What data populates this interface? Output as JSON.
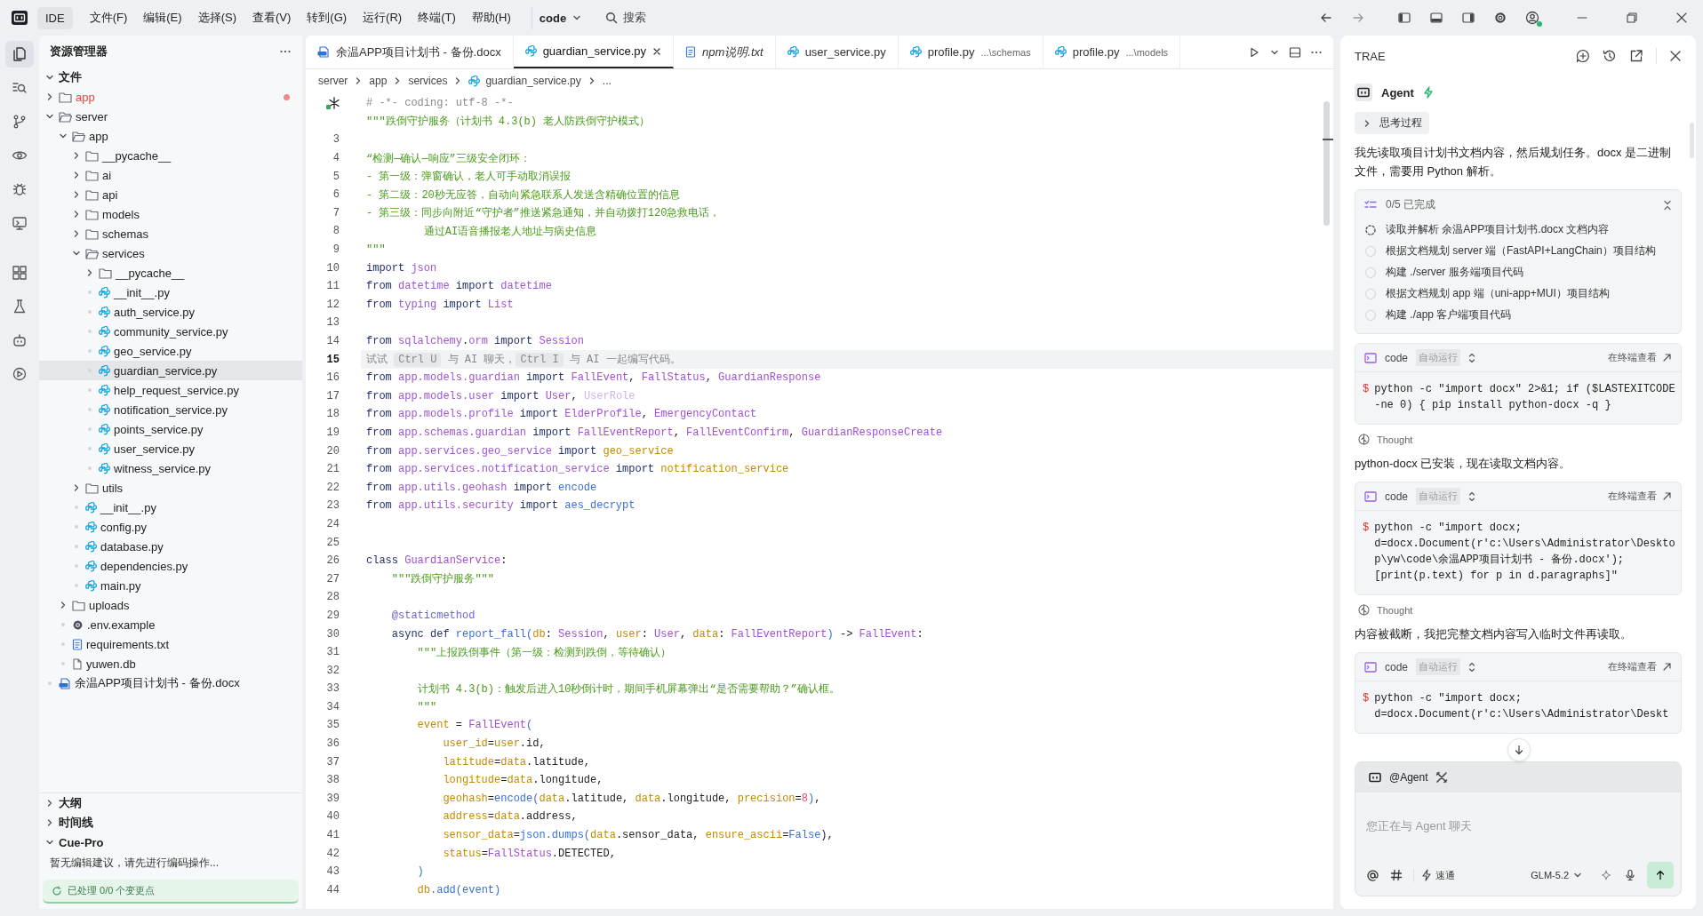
{
  "title_bar": {
    "app_label": "IDE",
    "menus": [
      "文件(F)",
      "编辑(E)",
      "选择(S)",
      "查看(V)",
      "转到(G)",
      "运行(R)",
      "终端(T)",
      "帮助(H)"
    ],
    "workspace": "code",
    "search": {
      "placeholder": "搜索"
    }
  },
  "activity_bar": [
    {
      "selected": true
    },
    {
      "selected": false
    },
    {
      "selected": false
    },
    {
      "selected": false
    },
    {
      "selected": false
    },
    {
      "selected": false
    },
    {
      "selected": false
    },
    {
      "selected": false
    },
    {
      "selected": false
    },
    {
      "selected": false
    }
  ],
  "explorer": {
    "title": "资源管理器",
    "section": {
      "label": "文件",
      "expanded": true
    },
    "tree": [
      {
        "name": "app",
        "kind": "folder",
        "expanded": false,
        "modified": true,
        "selected": false
      },
      {
        "name": "server",
        "kind": "folder",
        "expanded": true,
        "modified": false,
        "selected": false,
        "children": [
          {
            "name": "app",
            "kind": "folder",
            "expanded": true,
            "modified": false,
            "selected": false,
            "children": [
              {
                "name": "__pycache__",
                "kind": "folder",
                "expanded": false,
                "modified": false,
                "selected": false
              },
              {
                "name": "ai",
                "kind": "folder",
                "expanded": false,
                "modified": false,
                "selected": false
              },
              {
                "name": "api",
                "kind": "folder",
                "expanded": false,
                "modified": false,
                "selected": false
              },
              {
                "name": "models",
                "kind": "folder",
                "expanded": false,
                "modified": false,
                "selected": false
              },
              {
                "name": "schemas",
                "kind": "folder",
                "expanded": false,
                "modified": false,
                "selected": false
              },
              {
                "name": "services",
                "kind": "folder",
                "expanded": true,
                "modified": false,
                "selected": false,
                "children": [
                  {
                    "name": "__pycache__",
                    "kind": "folder",
                    "expanded": false,
                    "modified": false,
                    "selected": false
                  },
                  {
                    "name": "__init__.py",
                    "kind": "python",
                    "modified": false,
                    "selected": false
                  },
                  {
                    "name": "auth_service.py",
                    "kind": "python",
                    "modified": false,
                    "selected": false
                  },
                  {
                    "name": "community_service.py",
                    "kind": "python",
                    "modified": false,
                    "selected": false
                  },
                  {
                    "name": "geo_service.py",
                    "kind": "python",
                    "modified": false,
                    "selected": false
                  },
                  {
                    "name": "guardian_service.py",
                    "kind": "python",
                    "modified": false,
                    "selected": true
                  },
                  {
                    "name": "help_request_service.py",
                    "kind": "python",
                    "modified": false,
                    "selected": false
                  },
                  {
                    "name": "notification_service.py",
                    "kind": "python",
                    "modified": false,
                    "selected": false
                  },
                  {
                    "name": "points_service.py",
                    "kind": "python",
                    "modified": false,
                    "selected": false
                  },
                  {
                    "name": "user_service.py",
                    "kind": "python",
                    "modified": false,
                    "selected": false
                  },
                  {
                    "name": "witness_service.py",
                    "kind": "python",
                    "modified": false,
                    "selected": false
                  }
                ]
              },
              {
                "name": "utils",
                "kind": "folder",
                "expanded": false,
                "modified": false,
                "selected": false
              },
              {
                "name": "__init__.py",
                "kind": "python",
                "modified": false,
                "selected": false
              },
              {
                "name": "config.py",
                "kind": "python",
                "modified": false,
                "selected": false
              },
              {
                "name": "database.py",
                "kind": "python",
                "modified": false,
                "selected": false
              },
              {
                "name": "dependencies.py",
                "kind": "python",
                "modified": false,
                "selected": false
              },
              {
                "name": "main.py",
                "kind": "python",
                "modified": false,
                "selected": false
              }
            ]
          },
          {
            "name": "uploads",
            "kind": "folder",
            "expanded": false,
            "modified": false,
            "selected": false
          },
          {
            "name": ".env.example",
            "kind": "config",
            "modified": false,
            "selected": false
          },
          {
            "name": "requirements.txt",
            "kind": "text",
            "modified": false,
            "selected": false
          },
          {
            "name": "yuwen.db",
            "kind": "file",
            "modified": false,
            "selected": false
          }
        ]
      },
      {
        "name": "余温APP项目计划书 - 备份.docx",
        "kind": "document",
        "modified": false,
        "selected": false
      }
    ],
    "panels": [
      {
        "label": "大纲",
        "expanded": false
      },
      {
        "label": "时间线",
        "expanded": false
      },
      {
        "label": "Cue-Pro",
        "expanded": true,
        "message": "暂无编辑建议，请先进行编码操作...",
        "status": "已处理 0/0 个变更点"
      }
    ]
  },
  "editor": {
    "tabs": [
      {
        "label": "余温APP项目计划书 - 备份.docx",
        "kind": "document",
        "selected": false,
        "preview": false
      },
      {
        "label": "guardian_service.py",
        "kind": "python",
        "selected": true,
        "preview": false
      },
      {
        "label": "npm说明.txt",
        "kind": "text",
        "selected": false,
        "preview": true
      },
      {
        "label": "user_service.py",
        "kind": "python",
        "selected": false,
        "preview": false
      },
      {
        "label": "profile.py",
        "kind": "python",
        "selected": false,
        "preview": false,
        "path": "...\\schemas"
      },
      {
        "label": "profile.py",
        "kind": "python",
        "selected": false,
        "preview": false,
        "path": "...\\models"
      }
    ],
    "breadcrumb": [
      "server",
      "app",
      "services",
      "guardian_service.py",
      "..."
    ],
    "lines": [
      {
        "marker": true,
        "current": false,
        "tokens": [
          {
            "text": "# -*- coding: utf-8 -*-",
            "kind": "comment"
          }
        ]
      },
      {
        "current": false,
        "tokens": [
          {
            "text": "\"\"\"跌倒守护服务（计划书 4.3(b) 老人防跌倒守护模式）",
            "kind": "string"
          }
        ]
      },
      {
        "number": "3",
        "current": false
      },
      {
        "number": "4",
        "current": false,
        "tokens": [
          {
            "text": "“检测—确认—响应”三级安全闭环：",
            "kind": "string"
          }
        ]
      },
      {
        "number": "5",
        "current": false,
        "tokens": [
          {
            "text": "- 第一级：弹窗确认，老人可手动取消误报",
            "kind": "string"
          }
        ]
      },
      {
        "number": "6",
        "current": false,
        "tokens": [
          {
            "text": "- 第二级：20秒无应答，自动向紧急联系人发送含精确位置的信息",
            "kind": "string"
          }
        ]
      },
      {
        "number": "7",
        "current": false,
        "tokens": [
          {
            "text": "- 第三级：同步向附近“守护者”推送紧急通知，并自动拨打120急救电话，",
            "kind": "string"
          }
        ]
      },
      {
        "number": "8",
        "current": false,
        "tokens": [
          {
            "text": "         通过AI语音播报老人地址与病史信息",
            "kind": "string"
          }
        ]
      },
      {
        "number": "9",
        "current": false,
        "tokens": [
          {
            "text": "\"\"\"",
            "kind": "string"
          }
        ]
      },
      {
        "number": "10",
        "current": false,
        "tokens": [
          {
            "text": "import",
            "kind": "keyword"
          },
          {
            "text": " json",
            "kind": "module"
          }
        ]
      },
      {
        "number": "11",
        "current": false,
        "tokens": [
          {
            "text": "from",
            "kind": "keyword"
          },
          {
            "text": " datetime ",
            "kind": "module"
          },
          {
            "text": "import",
            "kind": "keyword"
          },
          {
            "text": " datetime",
            "kind": "module"
          }
        ]
      },
      {
        "number": "12",
        "current": false,
        "tokens": [
          {
            "text": "from",
            "kind": "keyword"
          },
          {
            "text": " typing ",
            "kind": "module"
          },
          {
            "text": "import",
            "kind": "keyword"
          },
          {
            "text": " List",
            "kind": "class"
          }
        ]
      },
      {
        "number": "13",
        "current": false
      },
      {
        "number": "14",
        "current": false,
        "tokens": [
          {
            "text": "from",
            "kind": "keyword"
          },
          {
            "text": " sqlalchemy",
            "kind": "module"
          },
          {
            "text": ".",
            "kind": "plain"
          },
          {
            "text": "orm ",
            "kind": "module"
          },
          {
            "text": "import",
            "kind": "keyword"
          },
          {
            "text": " Session",
            "kind": "class"
          }
        ]
      },
      {
        "number": "15",
        "current": true,
        "tokens": [
          {
            "text": "试试 ",
            "kind": "hint"
          },
          {
            "text": "Ctrl U",
            "kind": "key"
          },
          {
            "text": " 与 AI 聊天，",
            "kind": "hint"
          },
          {
            "text": "Ctrl I",
            "kind": "key"
          },
          {
            "text": " 与 AI 一起编写代码。",
            "kind": "hint"
          }
        ]
      },
      {
        "number": "16",
        "current": false,
        "tokens": [
          {
            "text": "from",
            "kind": "keyword"
          },
          {
            "text": " app.models.guardian ",
            "kind": "module"
          },
          {
            "text": "import",
            "kind": "keyword"
          },
          {
            "text": " FallEvent",
            "kind": "class"
          },
          {
            "text": ", ",
            "kind": "plain"
          },
          {
            "text": "FallStatus",
            "kind": "class"
          },
          {
            "text": ", ",
            "kind": "plain"
          },
          {
            "text": "GuardianResponse",
            "kind": "class"
          }
        ]
      },
      {
        "number": "17",
        "current": false,
        "tokens": [
          {
            "text": "from",
            "kind": "keyword"
          },
          {
            "text": " app.models.user ",
            "kind": "module"
          },
          {
            "text": "import",
            "kind": "keyword"
          },
          {
            "text": " User",
            "kind": "class"
          },
          {
            "text": ", ",
            "kind": "plain"
          },
          {
            "text": "UserRole",
            "kind": "unused"
          }
        ]
      },
      {
        "number": "18",
        "current": false,
        "tokens": [
          {
            "text": "from",
            "kind": "keyword"
          },
          {
            "text": " app.models.profile ",
            "kind": "module"
          },
          {
            "text": "import",
            "kind": "keyword"
          },
          {
            "text": " ElderProfile",
            "kind": "class"
          },
          {
            "text": ", ",
            "kind": "plain"
          },
          {
            "text": "EmergencyContact",
            "kind": "class"
          }
        ]
      },
      {
        "number": "19",
        "current": false,
        "tokens": [
          {
            "text": "from",
            "kind": "keyword"
          },
          {
            "text": " app.schemas.guardian ",
            "kind": "module"
          },
          {
            "text": "import",
            "kind": "keyword"
          },
          {
            "text": " FallEventReport",
            "kind": "class"
          },
          {
            "text": ", ",
            "kind": "plain"
          },
          {
            "text": "FallEventConfirm",
            "kind": "class"
          },
          {
            "text": ", ",
            "kind": "plain"
          },
          {
            "text": "GuardianResponseCreate",
            "kind": "class"
          }
        ]
      },
      {
        "number": "20",
        "current": false,
        "tokens": [
          {
            "text": "from",
            "kind": "keyword"
          },
          {
            "text": " app.services.geo_service ",
            "kind": "module"
          },
          {
            "text": "import",
            "kind": "keyword"
          },
          {
            "text": " geo_service",
            "kind": "variable"
          }
        ]
      },
      {
        "number": "21",
        "current": false,
        "tokens": [
          {
            "text": "from",
            "kind": "keyword"
          },
          {
            "text": " app.services.notification_service ",
            "kind": "module"
          },
          {
            "text": "import",
            "kind": "keyword"
          },
          {
            "text": " notification_service",
            "kind": "variable"
          }
        ]
      },
      {
        "number": "22",
        "current": false,
        "tokens": [
          {
            "text": "from",
            "kind": "keyword"
          },
          {
            "text": " app.utils.geohash ",
            "kind": "module"
          },
          {
            "text": "import",
            "kind": "keyword"
          },
          {
            "text": " encode",
            "kind": "function"
          }
        ]
      },
      {
        "number": "23",
        "current": false,
        "tokens": [
          {
            "text": "from",
            "kind": "keyword"
          },
          {
            "text": " app.utils.security ",
            "kind": "module"
          },
          {
            "text": "import",
            "kind": "keyword"
          },
          {
            "text": " aes_decrypt",
            "kind": "function"
          }
        ]
      },
      {
        "number": "24",
        "current": false
      },
      {
        "number": "25",
        "current": false
      },
      {
        "number": "26",
        "current": false,
        "tokens": [
          {
            "text": "class",
            "kind": "keyword"
          },
          {
            "text": " GuardianService",
            "kind": "class"
          },
          {
            "text": ":",
            "kind": "plain"
          }
        ]
      },
      {
        "number": "27",
        "current": false,
        "tokens": [
          {
            "text": "    \"\"\"跌倒守护服务\"\"\"",
            "kind": "string"
          }
        ]
      },
      {
        "number": "28",
        "current": false
      },
      {
        "number": "29",
        "current": false,
        "tokens": [
          {
            "text": "    @staticmethod",
            "kind": "decorator"
          }
        ]
      },
      {
        "number": "30",
        "current": false,
        "tokens": [
          {
            "text": "    async def",
            "kind": "keyword"
          },
          {
            "text": " report_fall",
            "kind": "function"
          },
          {
            "text": "(",
            "kind": "function"
          },
          {
            "text": "db",
            "kind": "variable"
          },
          {
            "text": ": ",
            "kind": "plain"
          },
          {
            "text": "Session",
            "kind": "class"
          },
          {
            "text": ", ",
            "kind": "plain"
          },
          {
            "text": "user",
            "kind": "variable"
          },
          {
            "text": ": ",
            "kind": "plain"
          },
          {
            "text": "User",
            "kind": "class"
          },
          {
            "text": ", ",
            "kind": "plain"
          },
          {
            "text": "data",
            "kind": "variable"
          },
          {
            "text": ": ",
            "kind": "plain"
          },
          {
            "text": "FallEventReport",
            "kind": "class"
          },
          {
            "text": ")",
            "kind": "function"
          },
          {
            "text": " -> ",
            "kind": "plain"
          },
          {
            "text": "FallEvent",
            "kind": "class"
          },
          {
            "text": ":",
            "kind": "plain"
          }
        ]
      },
      {
        "number": "31",
        "current": false,
        "tokens": [
          {
            "text": "        \"\"\"上报跌倒事件（第一级：检测到跌倒，等待确认）",
            "kind": "string"
          }
        ]
      },
      {
        "number": "32",
        "current": false
      },
      {
        "number": "33",
        "current": false,
        "tokens": [
          {
            "text": "        计划书 4.3(b)：触发后进入10秒倒计时，期间手机屏幕弹出“是否需要帮助？”确认框。",
            "kind": "string"
          }
        ]
      },
      {
        "number": "34",
        "current": false,
        "tokens": [
          {
            "text": "        \"\"\"",
            "kind": "string"
          }
        ]
      },
      {
        "number": "35",
        "current": false,
        "tokens": [
          {
            "text": "        event",
            "kind": "variable"
          },
          {
            "text": " = ",
            "kind": "plain"
          },
          {
            "text": "FallEvent",
            "kind": "class"
          },
          {
            "text": "(",
            "kind": "function"
          }
        ]
      },
      {
        "number": "36",
        "current": false,
        "tokens": [
          {
            "text": "            user_id",
            "kind": "variable"
          },
          {
            "text": "=",
            "kind": "plain"
          },
          {
            "text": "user",
            "kind": "variable"
          },
          {
            "text": ".id,",
            "kind": "plain"
          }
        ]
      },
      {
        "number": "37",
        "current": false,
        "tokens": [
          {
            "text": "            latitude",
            "kind": "variable"
          },
          {
            "text": "=",
            "kind": "plain"
          },
          {
            "text": "data",
            "kind": "variable"
          },
          {
            "text": ".latitude,",
            "kind": "plain"
          }
        ]
      },
      {
        "number": "38",
        "current": false,
        "tokens": [
          {
            "text": "            longitude",
            "kind": "variable"
          },
          {
            "text": "=",
            "kind": "plain"
          },
          {
            "text": "data",
            "kind": "variable"
          },
          {
            "text": ".longitude,",
            "kind": "plain"
          }
        ]
      },
      {
        "number": "39",
        "current": false,
        "tokens": [
          {
            "text": "            geohash",
            "kind": "variable"
          },
          {
            "text": "=",
            "kind": "plain"
          },
          {
            "text": "encode(",
            "kind": "function"
          },
          {
            "text": "data",
            "kind": "variable"
          },
          {
            "text": ".latitude, ",
            "kind": "plain"
          },
          {
            "text": "data",
            "kind": "variable"
          },
          {
            "text": ".longitude, ",
            "kind": "plain"
          },
          {
            "text": "precision",
            "kind": "variable"
          },
          {
            "text": "=",
            "kind": "plain"
          },
          {
            "text": "8",
            "kind": "number"
          },
          {
            "text": ")",
            "kind": "function"
          },
          {
            "text": ",",
            "kind": "plain"
          }
        ]
      },
      {
        "number": "40",
        "current": false,
        "tokens": [
          {
            "text": "            address",
            "kind": "variable"
          },
          {
            "text": "=",
            "kind": "plain"
          },
          {
            "text": "data",
            "kind": "variable"
          },
          {
            "text": ".address,",
            "kind": "plain"
          }
        ]
      },
      {
        "number": "41",
        "current": false,
        "tokens": [
          {
            "text": "            sensor_data",
            "kind": "variable"
          },
          {
            "text": "=",
            "kind": "plain"
          },
          {
            "text": "json.dumps(",
            "kind": "function"
          },
          {
            "text": "data",
            "kind": "variable"
          },
          {
            "text": ".sensor_data, ",
            "kind": "plain"
          },
          {
            "text": "ensure_ascii",
            "kind": "variable"
          },
          {
            "text": "=",
            "kind": "plain"
          },
          {
            "text": "False",
            "kind": "function"
          },
          {
            "text": "),",
            "kind": "plain"
          }
        ]
      },
      {
        "number": "42",
        "current": false,
        "tokens": [
          {
            "text": "            status",
            "kind": "variable"
          },
          {
            "text": "=",
            "kind": "plain"
          },
          {
            "text": "FallStatus",
            "kind": "class"
          },
          {
            "text": ".DETECTED,",
            "kind": "plain"
          }
        ]
      },
      {
        "number": "43",
        "current": false,
        "tokens": [
          {
            "text": "        )",
            "kind": "function"
          }
        ]
      },
      {
        "number": "44",
        "current": false,
        "tokens": [
          {
            "text": "        db",
            "kind": "variable"
          },
          {
            "text": ".add(event)",
            "kind": "function"
          }
        ]
      }
    ]
  },
  "assistant": {
    "title": "TRAE",
    "mode": "Agent",
    "messages": [
      {
        "kind": "toggle",
        "label": "思考过程",
        "expanded": false
      },
      {
        "kind": "text",
        "text": "我先读取项目计划书文档内容，然后规划任务。docx 是二进制文件，需要用 Python 解析。"
      },
      {
        "kind": "todo",
        "summary": "0/5 已完成",
        "items": [
          {
            "text": "读取并解析 余温APP项目计划书.docx 文档内容",
            "kind": "running"
          },
          {
            "text": "根据文档规划 server 端（FastAPI+LangChain）项目结构",
            "kind": "pending"
          },
          {
            "text": "构建 ./server 服务端项目代码",
            "kind": "pending"
          },
          {
            "text": "根据文档规划 app 端（uni-app+MUI）项目结构",
            "kind": "pending"
          },
          {
            "text": "构建 ./app 客户端项目代码",
            "kind": "pending"
          }
        ]
      },
      {
        "kind": "command",
        "label": "code",
        "run_mode": "自动运行",
        "link": "在终端查看",
        "prompt": "$",
        "command": "python -c \"import docx\" 2>&1; if ($LASTEXITCODE -ne 0) { pip install python-docx -q }"
      },
      {
        "kind": "thought",
        "label": "Thought"
      },
      {
        "kind": "text",
        "text": "python-docx 已安装，现在读取文档内容。"
      },
      {
        "kind": "command",
        "label": "code",
        "run_mode": "自动运行",
        "link": "在终端查看",
        "prompt": "$",
        "command": "python -c \"import docx; d=docx.Document(r'c:\\Users\\Administrator\\Desktop\\yw\\code\\余温APP项目计划书 - 备份.docx'); [print(p.text) for p in d.paragraphs]\""
      },
      {
        "kind": "thought",
        "label": "Thought"
      },
      {
        "kind": "text",
        "text": "内容被截断，我把完整文档内容写入临时文件再读取。"
      },
      {
        "kind": "command",
        "label": "code",
        "run_mode": "自动运行",
        "link": "在终端查看",
        "prompt": "$",
        "command": "python -c \"import docx; d=docx.Document(r'c:\\Users\\Administrator\\Deskt"
      }
    ],
    "input": {
      "mention": "@Agent",
      "placeholder": "您正在与 Agent 聊天",
      "speed": "速通",
      "model": "GLM-5.2"
    }
  }
}
